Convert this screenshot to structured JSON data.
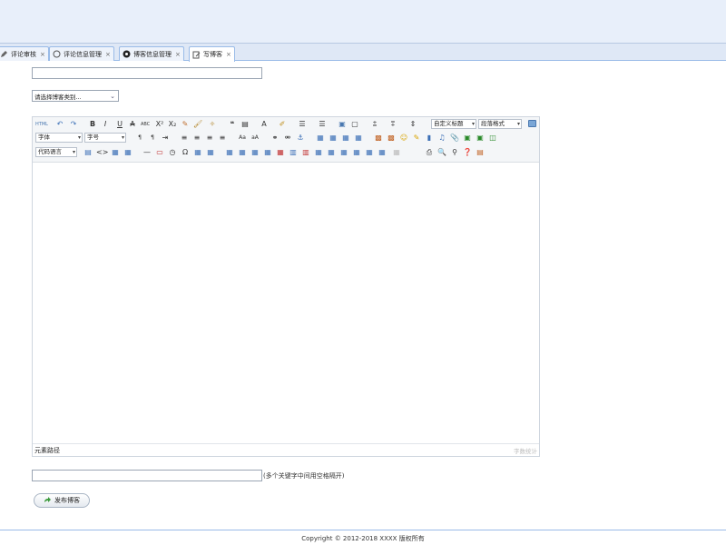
{
  "tabs": [
    {
      "label": "评论审核",
      "close": "×",
      "icon": "edit-icon"
    },
    {
      "label": "评论信息管理",
      "close": "×",
      "icon": "comment-icon"
    },
    {
      "label": "博客信息管理",
      "close": "×",
      "icon": "blog-icon"
    },
    {
      "label": "写博客",
      "close": "×",
      "icon": "write-icon",
      "active": true
    }
  ],
  "form": {
    "title_label": "",
    "type_label": "",
    "content_label": "",
    "type_select": {
      "selected": "请选择博客类别..."
    },
    "keywords_hint": "(多个关键字中间用空格隔开)",
    "publish_label": "发布博客"
  },
  "editor": {
    "font_family": "字体",
    "font_size": "字号",
    "custom_title": "自定义标题",
    "paragraph_format": "段落格式",
    "code_language": "代码语言",
    "element_path": "元素路径",
    "word_count": "字数统计"
  },
  "footer": {
    "copyright": "Copyright © 2012-2018 XXXX 版权所有"
  }
}
